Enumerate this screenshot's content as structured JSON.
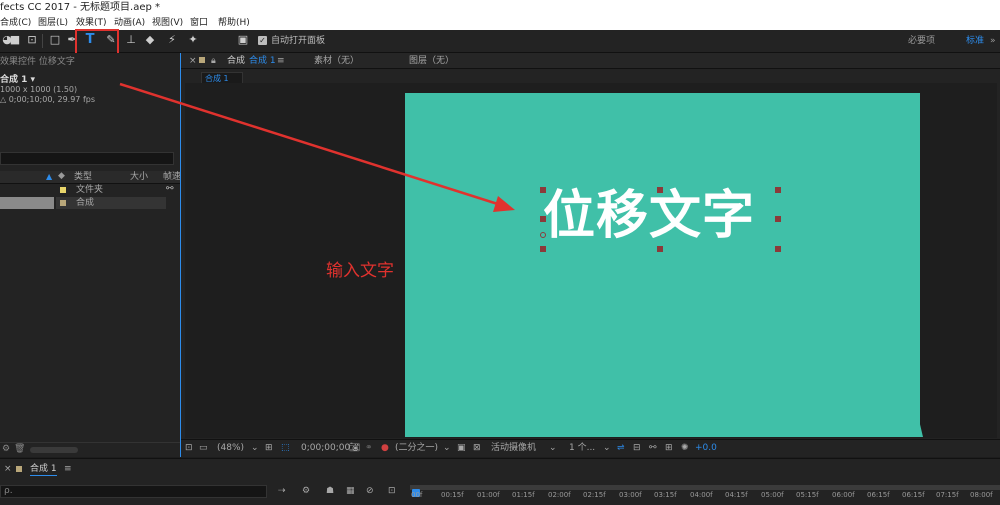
{
  "window": {
    "title": "fects CC 2017 - 无标题项目.aep *"
  },
  "menu": [
    "合成(C)",
    "图层(L)",
    "效果(T)",
    "动画(A)",
    "视图(V)",
    "窗口",
    "帮助(H)"
  ],
  "toolbar": {
    "auto_open_label": "自动打开面板",
    "workspace_essentials": "必要项",
    "workspace_standard": "标准",
    "workspace_more": "»"
  },
  "left_panel": {
    "tab_title": "效果控件 位移文字",
    "comp_name": "合成 1 ▾",
    "comp_size": "1000 x 1000 (1.50)",
    "comp_duration": "△ 0;00;10;00, 29.97 fps",
    "columns": {
      "type": "类型",
      "size": "大小",
      "axis": "帧速"
    },
    "rows": [
      {
        "type": "文件夹",
        "color": "#e8d56a",
        "selected": false
      },
      {
        "type": "合成",
        "color": "#b9a77a",
        "selected": true
      }
    ]
  },
  "viewer": {
    "tab_comp_label": "合成",
    "tab_comp_name": "合成 1",
    "tab_footage": "素材（无）",
    "tab_layer": "图层（无）",
    "subtab": "合成 1",
    "canvas_color": "#40c0a8",
    "canvas_text": "位移文字",
    "annotation": "输入文字"
  },
  "viewer_footer": {
    "zoom": "(48%)",
    "timecode": "0;00;00;00",
    "resolution": "(二分之一)",
    "camera": "活动摄像机",
    "views": "1 个...",
    "exposure": "+0.0"
  },
  "timeline": {
    "tab": "合成 1",
    "search_placeholder": "ρ.",
    "ticks": [
      "00f",
      "00:15f",
      "01:00f",
      "01:15f",
      "02:00f",
      "02:15f",
      "03:00f",
      "03:15f",
      "04:00f",
      "04:15f",
      "05:00f",
      "05:15f",
      "06:00f",
      "06:15f",
      "06:15f",
      "07:15f",
      "08:00f"
    ]
  },
  "colors": {
    "accent_blue": "#2d8ceb",
    "highlight_red": "#e0322e",
    "text_white": "#ffffff"
  }
}
